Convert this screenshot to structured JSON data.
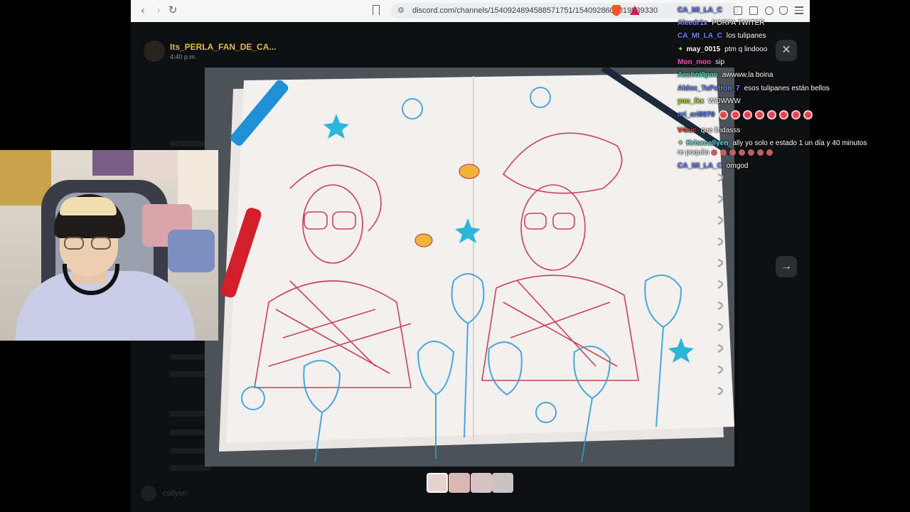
{
  "browser": {
    "url": "discord.com/channels/1540924894588571751/1540928608019939330",
    "back_icon": "arrow-left-icon",
    "forward_icon": "arrow-right-icon",
    "reload_icon": "reload-icon"
  },
  "post": {
    "author": "Its_PERLA_FAN_DE_CA...",
    "time": "4:40 p.m."
  },
  "viewer": {
    "close_label": "✕",
    "next_label": "→",
    "thumbnail_count": 4
  },
  "chat": [
    {
      "user": "CA_MI_LA_C",
      "text": "",
      "color": "#6f86ff"
    },
    {
      "user": "Aleedr1x",
      "text": "PORFA TWITER",
      "color": "#8a8cff"
    },
    {
      "user": "CA_MI_LA_C",
      "text": "los tulipanes",
      "color": "#6f86ff"
    },
    {
      "user": "may_0015",
      "text": "ptm q lindooo",
      "color": "#ffffff",
      "badge": "✦"
    },
    {
      "user": "Mon_moo",
      "text": "sip",
      "color": "#ff4fc3"
    },
    {
      "user": "Asshol3pao",
      "text": "awwww,la boina",
      "color": "#3fd6a8"
    },
    {
      "user": "Aldox_TuPatron_7",
      "text": "esos tulipanes están bellos",
      "color": "#6d8dff"
    },
    {
      "user": "yuu_ikx",
      "text": "WOWWW",
      "color": "#b8e03c"
    },
    {
      "user": "cri_cri8970",
      "text": "",
      "color": "#4f7dff",
      "hearts": 8
    },
    {
      "user": "V4nic",
      "text": "que lindasss",
      "color": "#ff3b3b"
    },
    {
      "user": "Krisxcallyen",
      "text": "ally yo solo e estado 1 un día y 40 minutos",
      "color": "#5fe0e0",
      "badge": "✦"
    },
    {
      "user": "",
      "text": "re poquito",
      "color": "#ffffff",
      "smileys": 7
    },
    {
      "user": "CA_MI_LA_C",
      "text": "omgod",
      "color": "#6f86ff"
    }
  ],
  "bottom": {
    "username": "callyen"
  },
  "colors": {
    "page_bg": "#000000",
    "chrome_bg": "#f7f7f8",
    "author_name": "#e0b84c"
  }
}
